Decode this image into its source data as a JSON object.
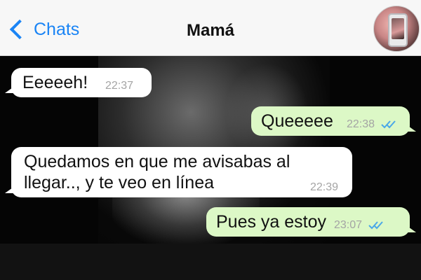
{
  "header": {
    "back_label": "Chats",
    "title": "Mamá"
  },
  "colors": {
    "accent": "#1a84f5",
    "incoming_bubble": "#ffffff",
    "outgoing_bubble": "#dcf8c6",
    "read_ticks": "#4aa7e8"
  },
  "messages": [
    {
      "direction": "in",
      "text": "Eeeeeh!",
      "time": "22:37"
    },
    {
      "direction": "out",
      "text": "Queeeee",
      "time": "22:38",
      "status": "read"
    },
    {
      "direction": "in",
      "text": "Quedamos en que me avisabas al llegar.., y te veo en línea",
      "time": "22:39"
    },
    {
      "direction": "out",
      "text": "Pues ya estoy",
      "time": "23:07",
      "status": "read"
    }
  ]
}
